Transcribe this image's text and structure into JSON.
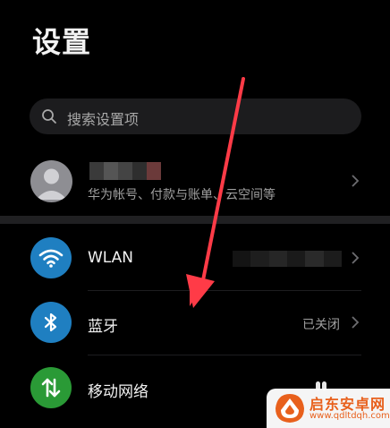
{
  "header": {
    "title": "设置"
  },
  "search": {
    "placeholder": "搜索设置项"
  },
  "account": {
    "subtitle": "华为帐号、付款与账单、云空间等"
  },
  "settings": {
    "wlan": {
      "label": "WLAN",
      "value": ""
    },
    "bluetooth": {
      "label": "蓝牙",
      "value": "已关闭"
    },
    "mobile_network": {
      "label": "移动网络"
    }
  },
  "watermark": {
    "title": "启东安卓网",
    "url": "www.qdltdqh.com"
  },
  "colors": {
    "background": "#000000",
    "wlan_icon_bg": "#1f7fc1",
    "bluetooth_icon_bg": "#1f7fc1",
    "mobile_icon_bg": "#2a9a36",
    "annotation_arrow": "#ff3b47"
  },
  "icons": {
    "search": "search-icon",
    "avatar": "user-avatar-icon",
    "wlan": "wifi-icon",
    "bluetooth": "bluetooth-icon",
    "mobile": "mobile-data-icon",
    "chevron": "chevron-right-icon"
  }
}
